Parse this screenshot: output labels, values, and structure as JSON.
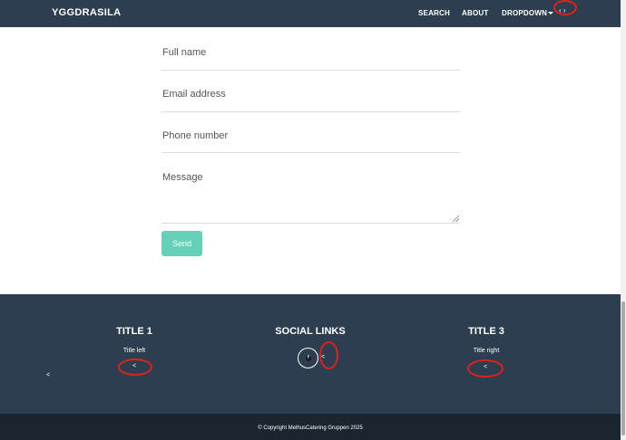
{
  "navbar": {
    "brand": "YGGDRASILA",
    "links": [
      "SEARCH",
      "ABOUT",
      "DROPDOWN"
    ],
    "toggle_glyph": "‹ ›"
  },
  "form": {
    "full_name_placeholder": "Full name",
    "email_placeholder": "Email address",
    "phone_placeholder": "Phone number",
    "message_placeholder": "Message",
    "send_label": "Send"
  },
  "footer": {
    "title_left": "TITLE 1",
    "title_center": "SOCIAL LINKS",
    "title_right": "TITLE 3",
    "text_left": "Title left",
    "text_right": "Title right",
    "angle_glyph": "<",
    "social_icon": "facebook-icon"
  },
  "bottom": {
    "copyright": "© Copyright MelhusCatering Gruppen 2025"
  },
  "colors": {
    "navbar_bg": "#2c3e50",
    "footer_bg": "#2c3e50",
    "bottombar_bg": "#1a252f",
    "accent": "#66d1b9",
    "annotation": "#e0201c"
  }
}
